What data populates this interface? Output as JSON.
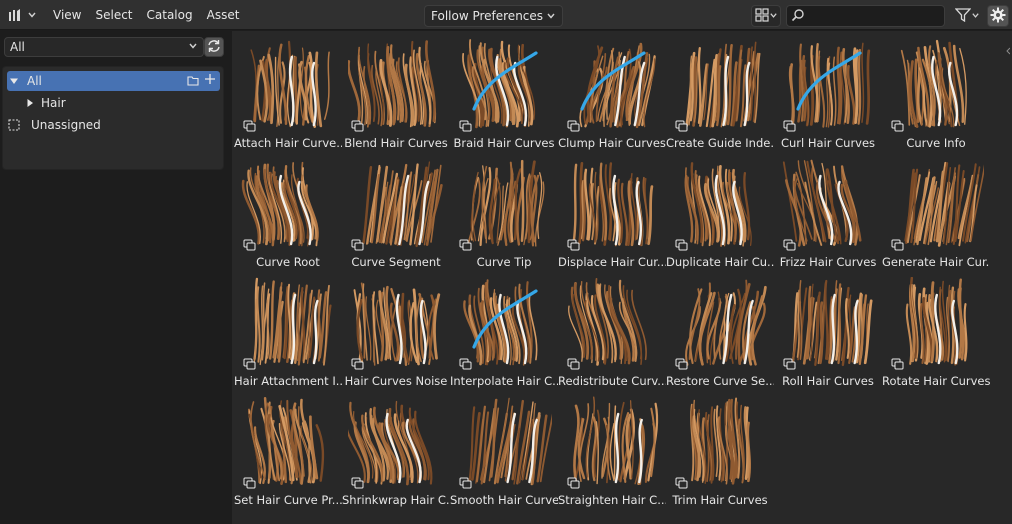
{
  "header": {
    "menus": [
      "View",
      "Select",
      "Catalog",
      "Asset"
    ],
    "import_method": "Follow Preferences",
    "search": {
      "value": "",
      "placeholder": ""
    }
  },
  "sidebar": {
    "library": "All",
    "catalogs": [
      {
        "label": "All",
        "expanded": true
      },
      {
        "label": "Hair",
        "expanded": false
      },
      {
        "label": "Unassigned"
      }
    ]
  },
  "assets": [
    {
      "name": "Attach Hair Curve..."
    },
    {
      "name": "Blend Hair Curves"
    },
    {
      "name": "Braid Hair Curves"
    },
    {
      "name": "Clump Hair Curves"
    },
    {
      "name": "Create Guide Inde..."
    },
    {
      "name": "Curl Hair Curves"
    },
    {
      "name": "Curve Info"
    },
    {
      "name": "Curve Root"
    },
    {
      "name": "Curve Segment"
    },
    {
      "name": "Curve Tip"
    },
    {
      "name": "Displace Hair Cur..."
    },
    {
      "name": "Duplicate Hair Cu..."
    },
    {
      "name": "Frizz Hair Curves"
    },
    {
      "name": "Generate Hair Cur..."
    },
    {
      "name": "Hair Attachment I..."
    },
    {
      "name": "Hair Curves Noise"
    },
    {
      "name": "Interpolate Hair C..."
    },
    {
      "name": "Redistribute Curv..."
    },
    {
      "name": "Restore Curve Se..."
    },
    {
      "name": "Roll Hair Curves"
    },
    {
      "name": "Rotate Hair Curves"
    },
    {
      "name": "Set Hair Curve Pr..."
    },
    {
      "name": "Shrinkwrap Hair C..."
    },
    {
      "name": "Smooth Hair Curves"
    },
    {
      "name": "Straighten Hair C..."
    },
    {
      "name": "Trim Hair Curves"
    }
  ],
  "colors": {
    "accent": "#4772b3",
    "hair": "#a0683a",
    "hair_highlight": "#d49a63",
    "guide_blue": "#35a7e8"
  }
}
